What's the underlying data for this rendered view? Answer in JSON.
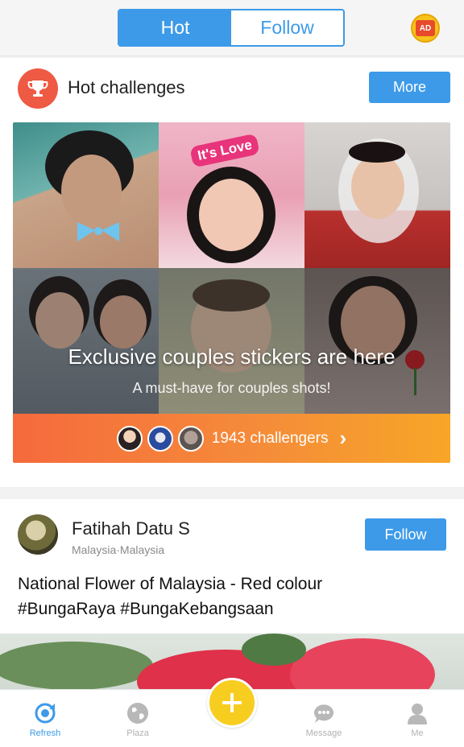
{
  "header": {
    "tabs": [
      {
        "label": "Hot",
        "active": true
      },
      {
        "label": "Follow",
        "active": false
      }
    ],
    "ad_badge_text": "AD"
  },
  "challenges": {
    "title": "Hot challenges",
    "more_label": "More",
    "banner_headline": "Exclusive couples stickers are here",
    "banner_subline": "A must-have for couples shots!",
    "sticker_text": "It's Love",
    "challengers_label": "1943 challengers",
    "accent_color": "#f5843a"
  },
  "post": {
    "author_name": "Fatihah Datu S",
    "author_location": "Malaysia·Malaysia",
    "follow_label": "Follow",
    "caption_line1": "National Flower of Malaysia - Red colour",
    "caption_line2": "#BungaRaya #BungaKebangsaan"
  },
  "nav": {
    "items": [
      {
        "label": "Refresh",
        "icon": "refresh-icon",
        "active": true
      },
      {
        "label": "Plaza",
        "icon": "globe-icon",
        "active": false
      },
      {
        "label": "Message",
        "icon": "chat-icon",
        "active": false
      },
      {
        "label": "Me",
        "icon": "person-icon",
        "active": false
      }
    ],
    "create_icon": "plus-icon"
  },
  "colors": {
    "primary_blue": "#3d9ae8",
    "fab_yellow": "#f7cd1f",
    "trophy_red": "#ee5a43"
  }
}
